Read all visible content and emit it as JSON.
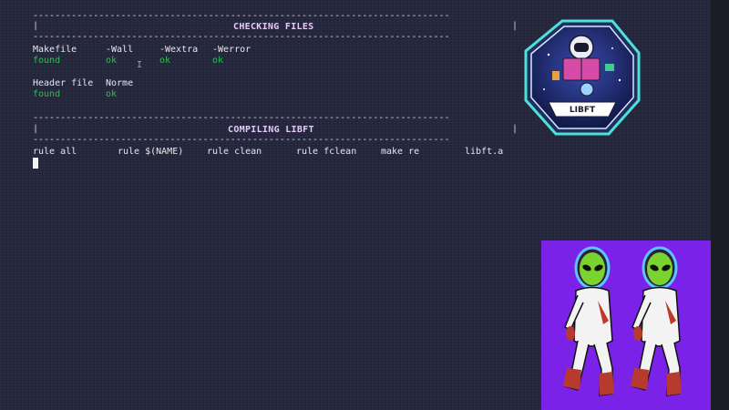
{
  "sections": [
    {
      "title": "CHECKING FILES"
    },
    {
      "title": "COMPILING LIBFT"
    }
  ],
  "checks_row1": {
    "headers": [
      "Makefile",
      "-Wall",
      "-Wextra",
      "-Werror"
    ],
    "values": [
      "found",
      "ok",
      "ok",
      "ok"
    ]
  },
  "checks_row2": {
    "headers": [
      "Header file",
      "Norme"
    ],
    "values": [
      "found",
      "ok"
    ]
  },
  "compile_rules": [
    "rule all",
    "rule $(NAME)",
    "rule clean",
    "rule fclean",
    "make re",
    "libft.a"
  ],
  "badge": {
    "label": "LIBFT"
  },
  "colors": {
    "ok": "#2fbf4f",
    "accent": "#e9c8ff",
    "background": "#23263a",
    "alien_bg": "#7b22e8"
  },
  "icons": [
    "text-cursor-icon",
    "libft-badge-icon",
    "dancing-alien-icon"
  ]
}
